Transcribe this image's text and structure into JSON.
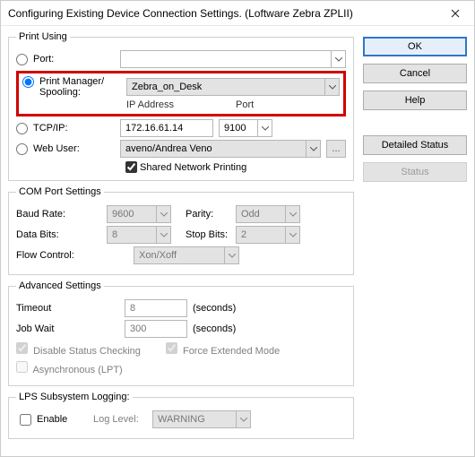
{
  "window": {
    "title": "Configuring Existing Device Connection Settings.  (Loftware Zebra ZPLII)"
  },
  "printUsing": {
    "legend": "Print Using",
    "port": {
      "label": "Port:",
      "value": ""
    },
    "printManager": {
      "label1": "Print Manager/",
      "label2": "Spooling:",
      "value": "Zebra_on_Desk",
      "ipLabel": "IP Address",
      "portLabel": "Port"
    },
    "tcpip": {
      "label": "TCP/IP:",
      "ip": "172.16.61.14",
      "port": "9100"
    },
    "webUser": {
      "label": "Web User:",
      "value": "aveno/Andrea Veno",
      "browse": "..."
    },
    "sharedNetwork": {
      "label": "Shared Network Printing"
    }
  },
  "comPort": {
    "legend": "COM Port Settings",
    "baudRate": {
      "label": "Baud Rate:",
      "value": "9600"
    },
    "parity": {
      "label": "Parity:",
      "value": "Odd"
    },
    "dataBits": {
      "label": "Data Bits:",
      "value": "8"
    },
    "stopBits": {
      "label": "Stop Bits:",
      "value": "2"
    },
    "flowControl": {
      "label": "Flow Control:",
      "value": "Xon/Xoff"
    }
  },
  "advanced": {
    "legend": "Advanced Settings",
    "timeout": {
      "label": "Timeout",
      "value": "8",
      "units": "(seconds)"
    },
    "jobWait": {
      "label": "Job Wait",
      "value": "300",
      "units": "(seconds)"
    },
    "disableStatus": {
      "label": "Disable Status Checking"
    },
    "forceExtended": {
      "label": "Force Extended Mode"
    },
    "asyncLpt": {
      "label": "Asynchronous (LPT)"
    }
  },
  "lps": {
    "legend": "LPS Subsystem Logging:",
    "enable": {
      "label": "Enable"
    },
    "logLevel": {
      "label": "Log Level:",
      "value": "WARNING"
    }
  },
  "buttons": {
    "ok": "OK",
    "cancel": "Cancel",
    "help": "Help",
    "detailedStatus": "Detailed Status",
    "status": "Status"
  }
}
